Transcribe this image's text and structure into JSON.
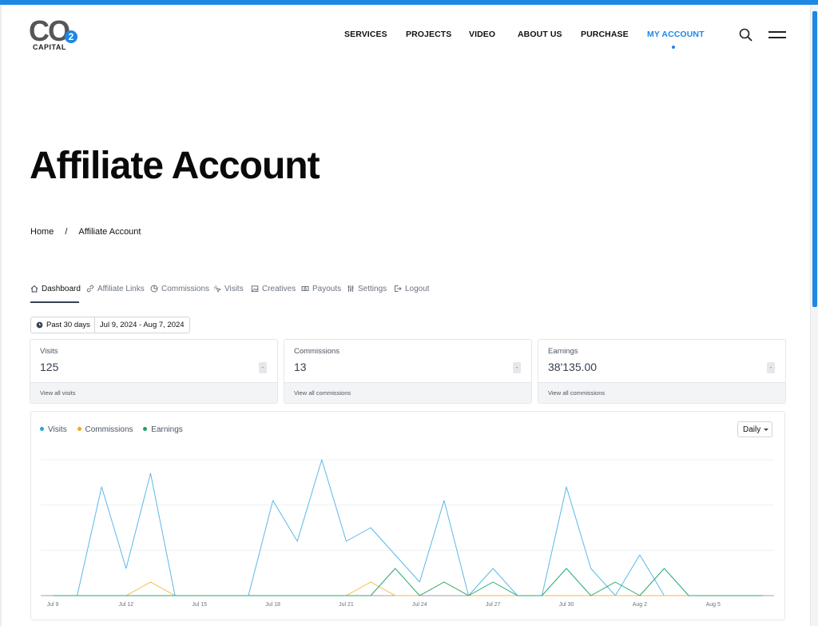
{
  "brand": {
    "logo_main": "CO",
    "logo_sub": "2",
    "logo_caption": "CAPITAL",
    "accent": "#1e88e5"
  },
  "nav": {
    "items": [
      {
        "label": "SERVICES",
        "active": false
      },
      {
        "label": "PROJECTS",
        "active": false
      },
      {
        "label": "VIDEO",
        "active": false
      },
      {
        "label": "ABOUT US",
        "active": false
      },
      {
        "label": "PURCHASE",
        "active": false
      },
      {
        "label": "MY ACCOUNT",
        "active": true
      }
    ],
    "search_icon": "search-icon",
    "menu_icon": "hamburger-menu-icon"
  },
  "page": {
    "title": "Affiliate Account"
  },
  "breadcrumb": {
    "home": "Home",
    "separator": "/",
    "current": "Affiliate Account"
  },
  "tabs": [
    {
      "label": "Dashboard",
      "icon": "home-icon",
      "active": true
    },
    {
      "label": "Affiliate Links",
      "icon": "link-icon",
      "active": false
    },
    {
      "label": "Commissions",
      "icon": "pie-chart-icon",
      "active": false
    },
    {
      "label": "Visits",
      "icon": "cursor-click-icon",
      "active": false
    },
    {
      "label": "Creatives",
      "icon": "image-icon",
      "active": false
    },
    {
      "label": "Payouts",
      "icon": "money-icon",
      "active": false
    },
    {
      "label": "Settings",
      "icon": "sliders-icon",
      "active": false
    },
    {
      "label": "Logout",
      "icon": "logout-icon",
      "active": false
    }
  ],
  "date_range": {
    "preset": "Past 30 days",
    "range": "Jul 9, 2024 - Aug 7, 2024"
  },
  "cards": [
    {
      "label": "Visits",
      "value": "125",
      "badge": "-",
      "link": "View all visits"
    },
    {
      "label": "Commissions",
      "value": "13",
      "badge": "-",
      "link": "View all commissions"
    },
    {
      "label": "Earnings",
      "value": "38'135.00",
      "badge": "-",
      "link": "View all commissions"
    }
  ],
  "chart": {
    "granularity": "Daily"
  },
  "chart_data": {
    "type": "line",
    "x": [
      "Jul 9",
      "Jul 10",
      "Jul 11",
      "Jul 12",
      "Jul 13",
      "Jul 14",
      "Jul 15",
      "Jul 16",
      "Jul 17",
      "Jul 18",
      "Jul 19",
      "Jul 20",
      "Jul 21",
      "Jul 22",
      "Jul 23",
      "Jul 24",
      "Jul 25",
      "Jul 26",
      "Jul 27",
      "Jul 28",
      "Jul 29",
      "Jul 30",
      "Jul 31",
      "Aug 1",
      "Aug 2",
      "Aug 3",
      "Aug 4",
      "Aug 5",
      "Aug 6",
      "Aug 7"
    ],
    "tick_labels": [
      "Jul 9",
      "Jul 12",
      "Jul 15",
      "Jul 18",
      "Jul 21",
      "Jul 24",
      "Jul 27",
      "Jul 30",
      "Aug 2",
      "Aug 5"
    ],
    "series": [
      {
        "name": "Visits",
        "color": "#5bb8e8",
        "values": [
          0,
          0,
          8,
          2,
          9,
          0,
          0,
          0,
          0,
          7,
          4,
          10,
          4,
          5,
          3,
          1,
          7,
          0,
          2,
          0,
          0,
          8,
          2,
          0,
          3,
          0,
          0,
          0,
          0,
          0
        ]
      },
      {
        "name": "Commissions",
        "color": "#f5b942",
        "values": [
          0,
          0,
          0,
          0,
          1,
          0,
          0,
          0,
          0,
          0,
          0,
          0,
          0,
          1,
          0,
          0,
          1,
          0,
          0,
          0,
          0,
          0,
          0,
          0,
          0,
          0,
          0,
          0,
          0,
          0
        ]
      },
      {
        "name": "Earnings",
        "color": "#2aa876",
        "values": [
          0,
          0,
          0,
          0,
          0,
          0,
          0,
          0,
          0,
          0,
          0,
          0,
          0,
          0,
          2,
          0,
          1,
          0,
          1,
          0,
          0,
          2,
          0,
          1,
          0,
          2,
          0,
          0,
          0,
          0
        ]
      }
    ],
    "ylim": [
      0,
      10
    ],
    "grid": true,
    "legend": "top-left"
  }
}
